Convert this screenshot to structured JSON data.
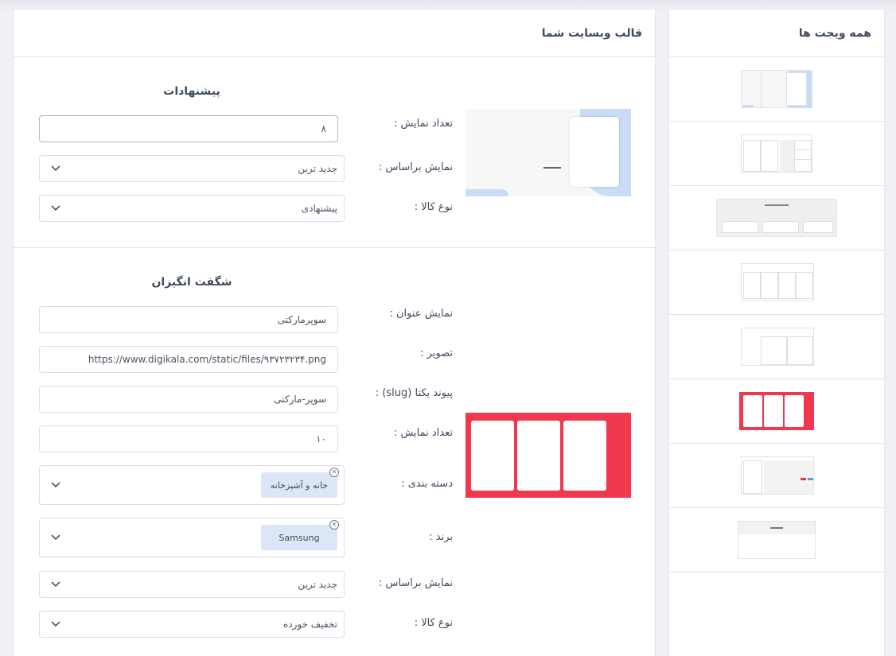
{
  "widgets_panel": {
    "title": "همه ویجت ها",
    "items": [
      "widget-1",
      "widget-2",
      "widget-3",
      "widget-4",
      "widget-5",
      "widget-6",
      "widget-7",
      "widget-8"
    ]
  },
  "template_panel": {
    "title": "قالب وبسایت شما"
  },
  "offers_section": {
    "title": "پیشنهادات",
    "count_label": "تعداد نمایش :",
    "count_value": "۸",
    "sort_label": "نمایش براساس :",
    "sort_value": "جدید ترین",
    "type_label": "نوع کالا :",
    "type_value": "پیشنهادی"
  },
  "amazing_section": {
    "title": "شگفت انگیزان",
    "title_label": "نمایش عنوان :",
    "title_value": "سوپرمارکتی",
    "image_label": "تصویر :",
    "image_value": "https://www.digikala.com/static/files/۹۳۷۲۳۲۳۴.png",
    "slug_label": "پیوند یکتا (slug) :",
    "slug_value": "سوپر-مارکتی",
    "count_label": "تعداد نمایش :",
    "count_value": "۱۰",
    "category_label": "دسته بندی :",
    "category_chip": "خانه و آشپزخانه",
    "brand_label": "برند :",
    "brand_chip": "Samsung",
    "sort_label": "نمایش براساس :",
    "sort_value": "جدید ترین",
    "type_label": "نوع کالا :",
    "type_value": "تخفیف خورده"
  },
  "colors": {
    "accent_red": "#f0394f",
    "preview_blue": "#c8dcf6",
    "chip_bg": "#dde6f6"
  }
}
